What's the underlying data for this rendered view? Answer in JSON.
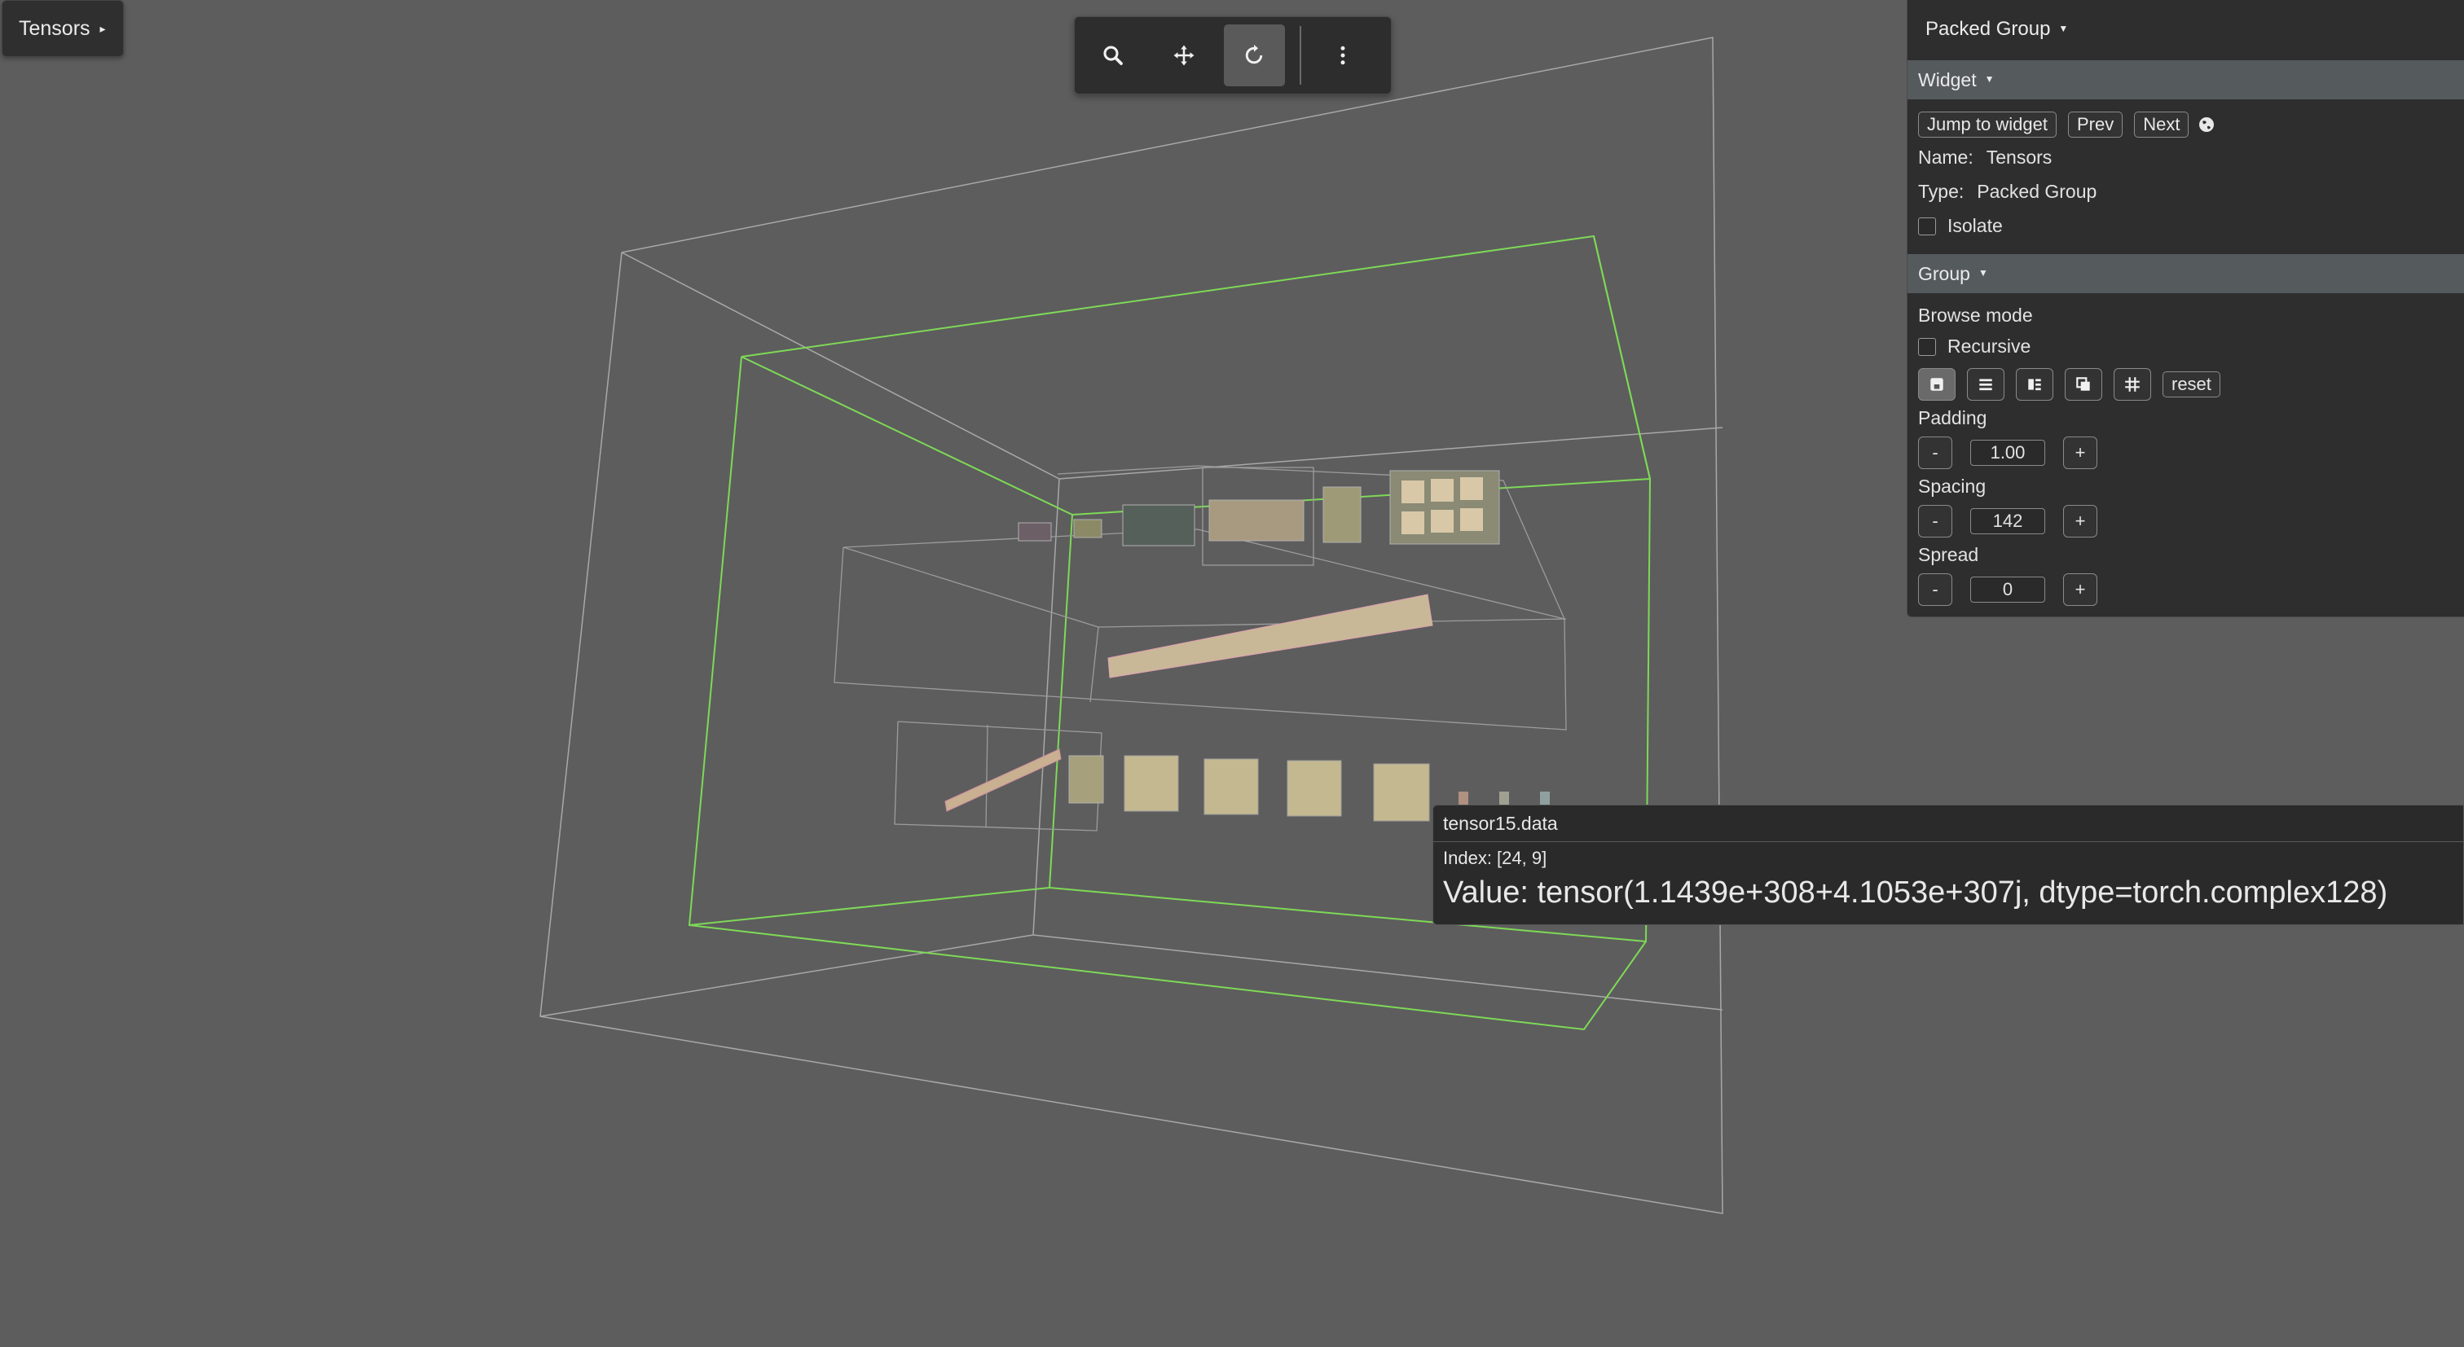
{
  "top_left": {
    "label": "Tensors"
  },
  "toolbar": {
    "tools": [
      {
        "name": "zoom",
        "icon": "magnifier-icon",
        "active": false
      },
      {
        "name": "pan",
        "icon": "move-arrows-icon",
        "active": false
      },
      {
        "name": "rotate",
        "icon": "rotate-icon",
        "active": true
      },
      {
        "name": "more",
        "icon": "more-vertical-icon",
        "active": false
      }
    ]
  },
  "panel": {
    "title": "Packed Group",
    "widget": {
      "header": "Widget",
      "jump_label": "Jump to widget",
      "prev_label": "Prev",
      "next_label": "Next",
      "name_key": "Name:",
      "name_value": "Tensors",
      "type_key": "Type:",
      "type_value": "Packed Group",
      "isolate_label": "Isolate"
    },
    "group": {
      "header": "Group",
      "browse_mode_label": "Browse mode",
      "recursive_label": "Recursive",
      "reset_label": "reset",
      "padding_label": "Padding",
      "padding_value": "1.00",
      "spacing_label": "Spacing",
      "spacing_value": "142",
      "spread_label": "Spread",
      "spread_value": "0",
      "minus": "-",
      "plus": "+"
    }
  },
  "tooltip": {
    "title": "tensor15.data",
    "index": "Index: [24, 9]",
    "value": "Value: tensor(1.1439e+308+4.1053e+307j, dtype=torch.complex128)"
  },
  "colors": {
    "background": "#5d5d5d",
    "selection_outline": "#7ed957",
    "outline": "#a9a9a9",
    "panel": "#2e2e2e",
    "section_header": "#555a5d"
  }
}
